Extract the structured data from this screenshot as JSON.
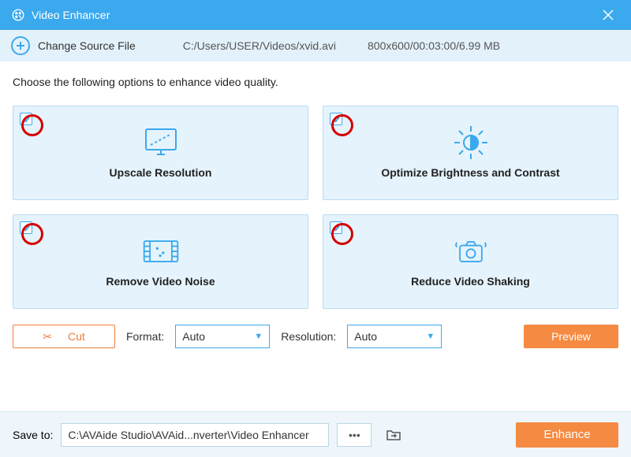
{
  "titlebar": {
    "title": "Video Enhancer"
  },
  "subbar": {
    "change_label": "Change Source File",
    "path": "C:/Users/USER/Videos/xvid.avi",
    "meta": "800x600/00:03:00/6.99 MB"
  },
  "instruction": "Choose the following options to enhance video quality.",
  "cards": [
    {
      "label": "Upscale Resolution",
      "checked": true
    },
    {
      "label": "Optimize Brightness and Contrast",
      "checked": true
    },
    {
      "label": "Remove Video Noise",
      "checked": true
    },
    {
      "label": "Reduce Video Shaking",
      "checked": true
    }
  ],
  "controls": {
    "cut": "Cut",
    "format_label": "Format:",
    "format_value": "Auto",
    "resolution_label": "Resolution:",
    "resolution_value": "Auto",
    "preview": "Preview"
  },
  "footer": {
    "save_label": "Save to:",
    "save_path": "C:\\AVAide Studio\\AVAid...nverter\\Video Enhancer",
    "enhance": "Enhance"
  }
}
